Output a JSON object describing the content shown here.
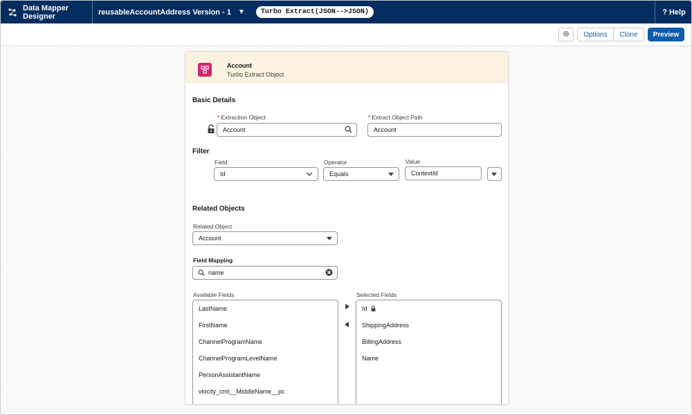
{
  "topbar": {
    "app_title": "Data Mapper Designer",
    "version_label": "reusableAccountAddress Version - 1",
    "type_badge": "Turbo Extract(JSON-->JSON)",
    "help_label": "? Help"
  },
  "toolbar": {
    "options_label": "Options",
    "clone_label": "Clone",
    "preview_label": "Preview"
  },
  "card": {
    "title": "Account",
    "subtitle": "Turbo Extract Object",
    "basic_details": {
      "heading": "Basic Details",
      "extraction_object_label": "Extraction Object",
      "extraction_object_value": "Account",
      "extract_path_label": "Extract Object Path",
      "extract_path_value": "Account"
    },
    "filter": {
      "heading": "Filter",
      "field_label": "Field",
      "field_value": "Id",
      "operator_label": "Operator",
      "operator_value": "Equals",
      "value_label": "Value",
      "value_value": "ContextId"
    },
    "related": {
      "heading": "Related Objects",
      "related_object_label": "Related Object",
      "related_object_value": "Account",
      "field_mapping_label": "Field Mapping",
      "search_value": "name",
      "available_label": "Available Fields",
      "selected_label": "Selected Fields",
      "available_fields": [
        "LastName",
        "FirstName",
        "ChannelProgramName",
        "ChannelProgramLevelName",
        "PersonAssistantName",
        "vlocity_cmt__MiddleName__pc"
      ],
      "selected_fields": [
        "Id",
        "ShippingAddress",
        "BillingAddress",
        "Name"
      ]
    }
  },
  "colors": {
    "topbar": "#032d60",
    "brand_blue": "#0b5cab",
    "header_bg": "#fbf3e0",
    "object_icon": "#d6246e",
    "required": "#ba0517"
  }
}
